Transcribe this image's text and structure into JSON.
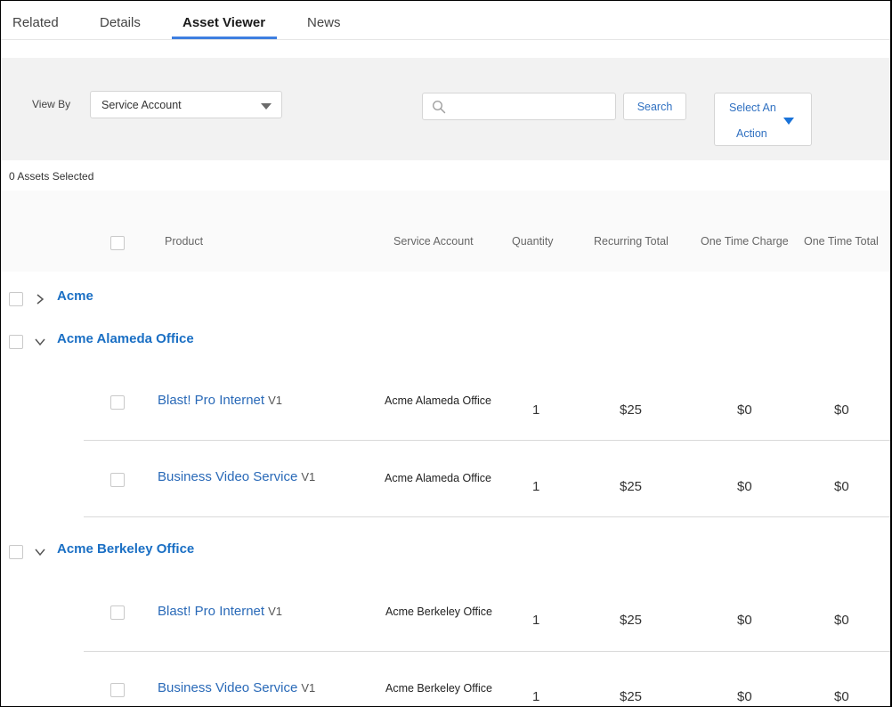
{
  "tabs": [
    {
      "label": "Related",
      "active": false
    },
    {
      "label": "Details",
      "active": false
    },
    {
      "label": "Asset Viewer",
      "active": true
    },
    {
      "label": "News",
      "active": false
    }
  ],
  "filters": {
    "view_by_label": "View By",
    "view_by_value": "Service Account",
    "search_value": "",
    "search_placeholder": "",
    "search_button": "Search",
    "action_button_line1": "Select An",
    "action_button_line2": "Action"
  },
  "selected_count": "0 Assets Selected",
  "columns": [
    "Product",
    "Service Account",
    "Quantity",
    "Recurring Total",
    "One Time Charge",
    "One Time Total"
  ],
  "groups": [
    {
      "name": "Acme",
      "expanded": false,
      "items": []
    },
    {
      "name": "Acme Alameda Office",
      "expanded": true,
      "items": [
        {
          "product": "Blast! Pro Internet",
          "version": "V1",
          "service_account": "Acme Alameda Office",
          "quantity": "1",
          "recurring_total": "$25",
          "one_time_charge": "$0",
          "one_time_total": "$0"
        },
        {
          "product": "Business Video Service",
          "version": "V1",
          "service_account": "Acme Alameda Office",
          "quantity": "1",
          "recurring_total": "$25",
          "one_time_charge": "$0",
          "one_time_total": "$0"
        }
      ]
    },
    {
      "name": "Acme Berkeley Office",
      "expanded": true,
      "items": [
        {
          "product": "Blast! Pro Internet",
          "version": "V1",
          "service_account": "Acme Berkeley Office",
          "quantity": "1",
          "recurring_total": "$25",
          "one_time_charge": "$0",
          "one_time_total": "$0"
        },
        {
          "product": "Business Video Service",
          "version": "V1",
          "service_account": "Acme Berkeley Office",
          "quantity": "1",
          "recurring_total": "$25",
          "one_time_charge": "$0",
          "one_time_total": "$0"
        }
      ]
    }
  ],
  "colors": {
    "tab_underline": "#3e7fe0",
    "link_blue": "#1a6fc4",
    "panel_bg": "#f2f2f2"
  }
}
